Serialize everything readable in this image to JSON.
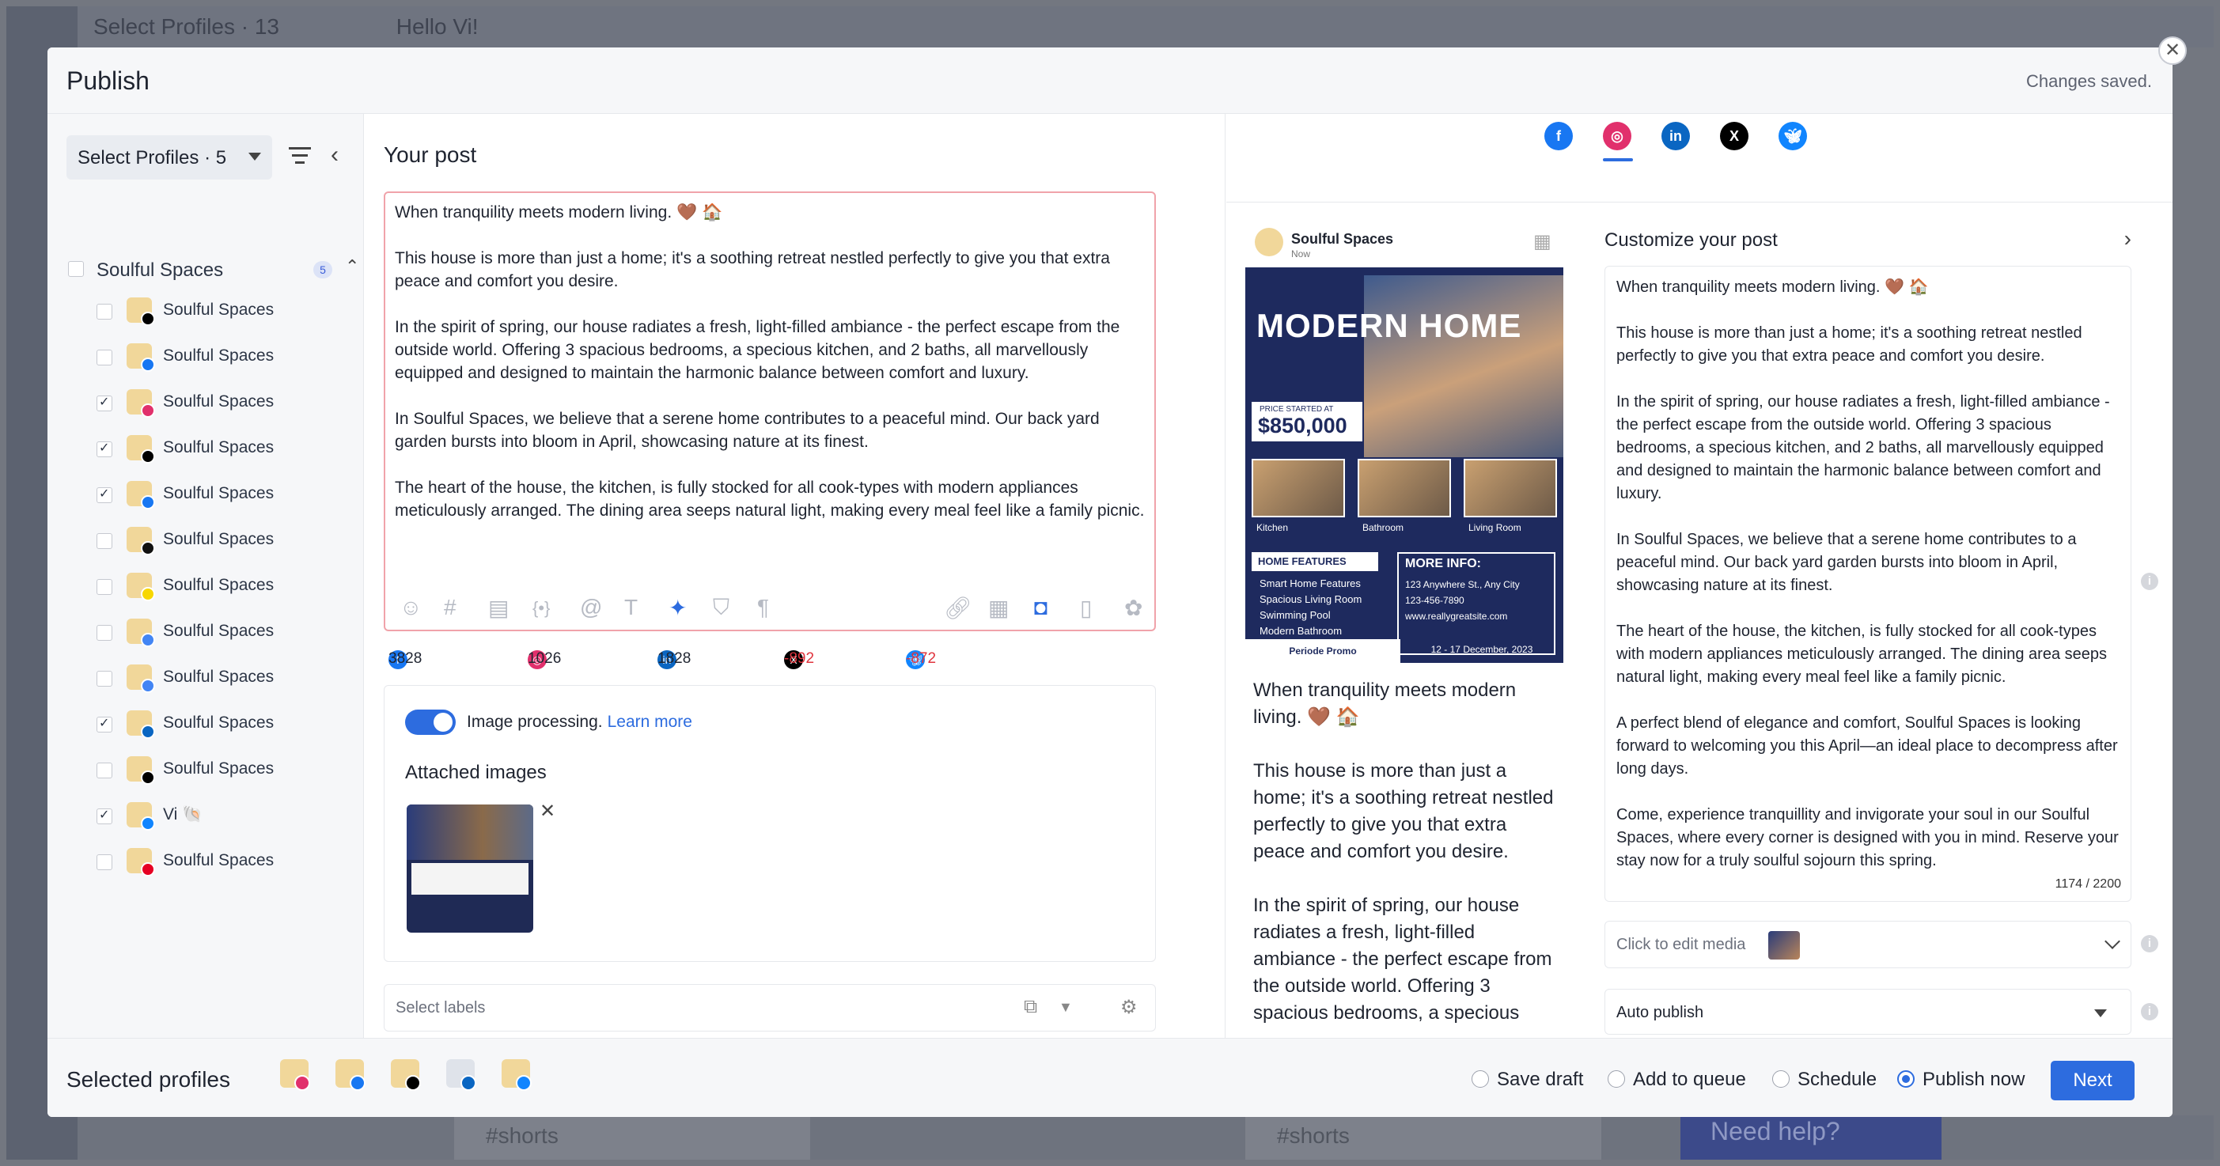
{
  "background": {
    "top_bar_items": [
      "Select Profiles · 13",
      "Hello Vi!"
    ],
    "bottom_cards": [
      "#shorts",
      "#shorts"
    ],
    "need_help": "Need help?"
  },
  "modal": {
    "title": "Publish",
    "status": "Changes saved.",
    "close_icon": "close-icon"
  },
  "sidebar": {
    "select_profiles": "Select Profiles · 5",
    "group": {
      "label": "Soulful Spaces",
      "count": "5"
    },
    "profiles": [
      {
        "label": "Soulful Spaces",
        "network": "threads",
        "checked": false
      },
      {
        "label": "Soulful Spaces",
        "network": "facebook",
        "checked": false
      },
      {
        "label": "Soulful Spaces",
        "network": "instagram",
        "checked": true
      },
      {
        "label": "Soulful Spaces",
        "network": "x",
        "checked": true
      },
      {
        "label": "Soulful Spaces",
        "network": "facebook",
        "checked": true
      },
      {
        "label": "Soulful Spaces",
        "network": "tiktok",
        "checked": false
      },
      {
        "label": "Soulful Spaces",
        "network": "snapchat",
        "checked": false
      },
      {
        "label": "Soulful Spaces",
        "network": "google-business",
        "checked": false
      },
      {
        "label": "Soulful Spaces",
        "network": "google-business",
        "checked": false
      },
      {
        "label": "Soulful Spaces",
        "network": "linkedin",
        "checked": true
      },
      {
        "label": "Soulful Spaces",
        "network": "threads",
        "checked": false
      },
      {
        "label": "Vi 🐚",
        "network": "bluesky",
        "checked": true
      },
      {
        "label": "Soulful Spaces",
        "network": "pinterest",
        "checked": false
      }
    ]
  },
  "composer": {
    "heading": "Your post",
    "paragraphs": [
      "When tranquility meets modern living. 🤎 🏠",
      "This house is more than just a home; it's a soothing retreat nestled perfectly to give you that extra peace and comfort you desire.",
      "In the spirit of spring, our house radiates a fresh, light-filled ambiance - the perfect escape from the outside world. Offering 3 spacious bedrooms, a specious kitchen, and 2 baths, all marvellously equipped and designed to maintain the harmonic balance between comfort and luxury.",
      "In Soulful Spaces, we believe that a serene home contributes to a peaceful mind. Our back yard garden bursts into bloom in April, showcasing nature at its finest.",
      "The heart of the house, the kitchen, is fully stocked for all cook-types with modern appliances meticulously arranged. The dining area seeps natural light, making every meal feel like a family picnic."
    ],
    "char_counts": [
      {
        "network": "facebook",
        "value": "3828"
      },
      {
        "network": "instagram",
        "value": "1026"
      },
      {
        "network": "linkedin",
        "value": "1828"
      },
      {
        "network": "x",
        "value": "-892"
      },
      {
        "network": "bluesky",
        "value": "-872"
      }
    ],
    "image_processing": "Image processing.",
    "learn_more": "Learn more",
    "attached_images": "Attached images",
    "select_labels": "Select labels"
  },
  "networks_tabs": [
    "facebook",
    "instagram",
    "linkedin",
    "x",
    "bluesky"
  ],
  "preview": {
    "name": "Soulful Spaces",
    "time": "Now",
    "image": {
      "headline": "MODERN HOME",
      "price_label": "PRICE STARTED AT",
      "price": "$850,000",
      "rooms": [
        "Kitchen",
        "Bathroom",
        "Living Room"
      ],
      "features_title": "HOME FEATURES",
      "features": [
        "Smart Home Features",
        "Spacious Living Room",
        "Swimming Pool",
        "Modern Bathroom"
      ],
      "more_info_title": "MORE INFO:",
      "more_info": [
        "123 Anywhere St., Any City",
        "123-456-7890",
        "www.reallygreatsite.com"
      ],
      "promo_label": "Periode Promo",
      "promo_dates": "12 - 17 December, 2023"
    },
    "paragraphs": [
      "When tranquility meets modern living. 🤎 🏠",
      "This house is more than just a home; it's a soothing retreat nestled perfectly to give you that extra peace and comfort you desire.",
      "In the spirit of spring, our house radiates a fresh, light-filled ambiance - the perfect escape from the outside world. Offering 3 spacious bedrooms, a specious"
    ]
  },
  "customize": {
    "title": "Customize your post",
    "paragraphs": [
      "When tranquility meets modern living. 🤎 🏠",
      "This house is more than just a home; it's a soothing retreat nestled perfectly to give you that extra peace and comfort you desire.",
      "In the spirit of spring, our house radiates a fresh, light-filled ambiance - the perfect escape from the outside world. Offering 3 spacious bedrooms, a specious kitchen, and 2 baths, all marvellously equipped and designed to maintain the harmonic balance between comfort and luxury.",
      "In Soulful Spaces, we believe that a serene home contributes to a peaceful mind. Our back yard garden bursts into bloom in April, showcasing nature at its finest.",
      "The heart of the house, the kitchen, is fully stocked for all cook-types with modern appliances meticulously arranged. The dining area seeps natural light, making every meal feel like a family picnic.",
      "A perfect blend of elegance and comfort, Soulful Spaces is looking forward to welcoming you this April—an ideal place to decompress after long days.",
      "Come, experience tranquillity and invigorate your soul in our Soulful Spaces, where every corner is designed with you in mind. Reserve your stay now for a truly soulful sojourn this spring."
    ],
    "char_count": "1174 / 2200",
    "media": "Click to edit media",
    "auto_publish": "Auto publish"
  },
  "footer": {
    "selected_profiles": "Selected profiles",
    "selected_networks": [
      "instagram",
      "facebook",
      "x",
      "linkedin",
      "bluesky"
    ],
    "options": [
      {
        "label": "Save draft",
        "selected": false
      },
      {
        "label": "Add to queue",
        "selected": false
      },
      {
        "label": "Schedule",
        "selected": false
      },
      {
        "label": "Publish now",
        "selected": true
      }
    ],
    "next": "Next"
  },
  "colors": {
    "accent": "#2d6cdf",
    "facebook": "#1877f2",
    "instagram": "#e1306c",
    "linkedin": "#0a66c2",
    "x": "#000000",
    "bluesky": "#1185fe",
    "error": "#e0343d"
  }
}
